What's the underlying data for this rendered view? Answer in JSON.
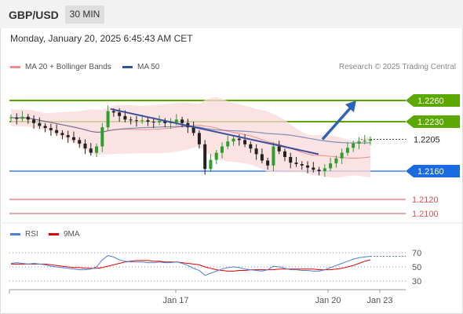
{
  "header": {
    "symbol": "GBP/USD",
    "timeframe": "30 MIN"
  },
  "datetime": "Monday, January 20, 2025 6:45:43 AM CET",
  "legend": {
    "ma20_bb": "MA 20 + Bollinger Bands",
    "ma50": "MA 50",
    "research": "Research © 2025 Trading Central",
    "colors": {
      "ma20": "#f28b8b",
      "ma50": "#2b5797"
    }
  },
  "chart_data": [
    {
      "type": "candlestick",
      "levels": [
        {
          "value": "1.2260",
          "color": "#5aa800",
          "kind": "resistance"
        },
        {
          "value": "1.2230",
          "color": "#5aa800",
          "kind": "resistance"
        },
        {
          "value": "1.2205",
          "color": "#222222",
          "kind": "last price"
        },
        {
          "value": "1.2160",
          "color": "#1a6be0",
          "kind": "pivot"
        },
        {
          "value": "1.2120",
          "color": "#e24d4d",
          "kind": "support"
        },
        {
          "value": "1.2100",
          "color": "#e24d4d",
          "kind": "support"
        }
      ],
      "x_ticks": [
        "Jan 17",
        "Jan 20",
        "Jan 23"
      ],
      "close": [
        1.2236,
        1.2234,
        1.2237,
        1.2233,
        1.2228,
        1.2224,
        1.2221,
        1.2218,
        1.2214,
        1.2211,
        1.2208,
        1.2204,
        1.2199,
        1.2192,
        1.2186,
        1.2195,
        1.2222,
        1.2245,
        1.2243,
        1.2238,
        1.2233,
        1.2232,
        1.2231,
        1.2232,
        1.223,
        1.2229,
        1.2231,
        1.2228,
        1.2229,
        1.2233,
        1.2228,
        1.2222,
        1.2214,
        1.2198,
        1.2163,
        1.2176,
        1.2186,
        1.2195,
        1.2202,
        1.2206,
        1.2204,
        1.2198,
        1.2192,
        1.2184,
        1.2175,
        1.2168,
        1.2195,
        1.2188,
        1.218,
        1.2172,
        1.217,
        1.2168,
        1.2165,
        1.2162,
        1.216,
        1.2164,
        1.2171,
        1.2178,
        1.2186,
        1.2193,
        1.2199,
        1.2202,
        1.2203,
        1.2205
      ],
      "trendlines": [
        {
          "from": [
            0.255,
            1.2248
          ],
          "to": [
            0.78,
            1.2184
          ]
        }
      ],
      "forecast_arrow": {
        "from": [
          0.79,
          1.2205
        ],
        "to": [
          0.875,
          1.226
        ]
      }
    },
    {
      "type": "line",
      "title": "RSI",
      "series": [
        {
          "name": "RSI",
          "color": "#4f7fd9"
        },
        {
          "name": "9MA",
          "color": "#e00000"
        }
      ],
      "y_ticks": [
        "70",
        "50",
        "30"
      ],
      "rsi": [
        55,
        56,
        55,
        54,
        55,
        54,
        53,
        51,
        50,
        49,
        48,
        47,
        46,
        46,
        47,
        50,
        60,
        66,
        64,
        60,
        58,
        57,
        57,
        57,
        56,
        56,
        57,
        56,
        56,
        57,
        55,
        52,
        48,
        45,
        38,
        41,
        44,
        47,
        49,
        50,
        49,
        47,
        46,
        45,
        44,
        46,
        51,
        50,
        48,
        46,
        46,
        45,
        45,
        44,
        44,
        46,
        49,
        52,
        55,
        58,
        61,
        63,
        64,
        65
      ],
      "ma9": [
        54,
        54,
        54,
        54,
        54,
        54,
        54,
        53,
        52,
        51,
        50,
        49,
        49,
        48,
        48,
        48,
        49,
        51,
        53,
        55,
        57,
        58,
        59,
        59,
        59,
        58,
        58,
        57,
        57,
        57,
        56,
        55,
        54,
        53,
        50,
        48,
        46,
        45,
        44,
        44,
        45,
        45,
        46,
        46,
        46,
        46,
        46,
        47,
        47,
        47,
        47,
        47,
        47,
        47,
        46,
        46,
        46,
        47,
        48,
        50,
        52,
        55,
        58,
        60
      ]
    }
  ]
}
